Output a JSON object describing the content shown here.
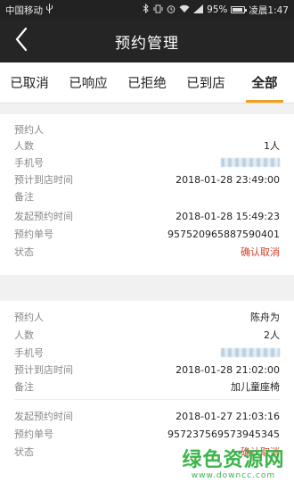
{
  "status_bar": {
    "carrier": "中国移动",
    "battery": "95%",
    "time_text": "凌晨1:47"
  },
  "header": {
    "title": "预约管理"
  },
  "tabs": [
    {
      "label": "已取消"
    },
    {
      "label": "已响应"
    },
    {
      "label": "已拒绝"
    },
    {
      "label": "已到店"
    },
    {
      "label": "全部",
      "active": true
    }
  ],
  "bookings": [
    {
      "rows": [
        {
          "label": "预约人",
          "value": ""
        },
        {
          "label": "人数",
          "value": "1人"
        },
        {
          "label": "手机号",
          "value": "",
          "blurred": true
        },
        {
          "label": "预计到店时间",
          "value": "2018-01-28 23:49:00"
        },
        {
          "label": "备注",
          "value": ""
        },
        {
          "label": "发起预约时间",
          "value": "2018-01-28 15:49:23"
        },
        {
          "label": "预约单号",
          "value": "957520965887590401"
        },
        {
          "label": "状态",
          "value": "确认取消"
        }
      ]
    },
    {
      "rows": [
        {
          "label": "预约人",
          "value": "陈舟为"
        },
        {
          "label": "人数",
          "value": "2人"
        },
        {
          "label": "手机号",
          "value": "",
          "blurred": true
        },
        {
          "label": "预计到店时间",
          "value": "2018-01-28 21:02:00"
        },
        {
          "label": "备注",
          "value": "加儿童座椅"
        },
        {
          "label": "发起预约时间",
          "value": "2018-01-27 21:03:16"
        },
        {
          "label": "预约单号",
          "value": "957237569573945345"
        },
        {
          "label": "状态",
          "value": "确认取消"
        }
      ]
    }
  ],
  "watermark": {
    "text": "绿色资源网",
    "url": "www.downcc.com"
  },
  "colors": {
    "accent": "#f0a020",
    "danger": "#d0402a",
    "watermark": "#3bb54a"
  }
}
